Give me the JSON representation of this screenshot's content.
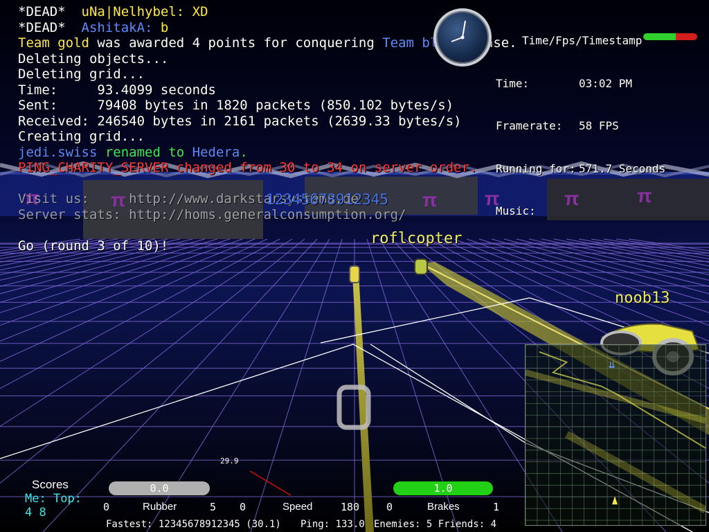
{
  "console": {
    "lines": [
      {
        "parts": [
          {
            "text": "*DEAD*  ",
            "color": "dead"
          },
          {
            "text": "uNa|Nelhybel: XD",
            "color": "gold"
          }
        ]
      },
      {
        "parts": [
          {
            "text": "*DEAD*  ",
            "color": "dead"
          },
          {
            "text": "AshitakA: ",
            "color": "blue"
          },
          {
            "text": "b",
            "color": "gold"
          }
        ]
      },
      {
        "parts": [
          {
            "text": "Team gold",
            "color": "gold"
          },
          {
            "text": " was awarded 4 points for conquering ",
            "color": "dead"
          },
          {
            "text": "Team blue",
            "color": "blue"
          },
          {
            "text": "'s base.",
            "color": "dead"
          }
        ]
      },
      {
        "parts": [
          {
            "text": "Deleting objects...",
            "color": "dead"
          }
        ]
      },
      {
        "parts": [
          {
            "text": "Deleting grid...",
            "color": "dead"
          }
        ]
      },
      {
        "parts": [
          {
            "text": "Time:     93.4099 seconds",
            "color": "dead"
          }
        ]
      },
      {
        "parts": [
          {
            "text": "Sent:     79408 bytes in 1820 packets (850.102 bytes/s)",
            "color": "dead"
          }
        ]
      },
      {
        "parts": [
          {
            "text": "Received: 246540 bytes in 2161 packets (2639.33 bytes/s)",
            "color": "dead"
          }
        ]
      },
      {
        "parts": [
          {
            "text": "Creating grid...",
            "color": "dead"
          }
        ]
      },
      {
        "parts": [
          {
            "text": "jedi.swiss",
            "color": "blue"
          },
          {
            "text": " renamed to ",
            "color": "green"
          },
          {
            "text": "Hedera",
            "color": "blue"
          },
          {
            "text": ".",
            "color": "green"
          }
        ]
      },
      {
        "parts": [
          {
            "text": "PING_CHARITY_SERVER changed from 30 to 34 on server order.",
            "color": "red"
          }
        ]
      },
      {
        "parts": [
          {
            "text": "",
            "color": "dead"
          }
        ]
      },
      {
        "parts": [
          {
            "text": "Visit us:     http://www.darkstarsystems.de",
            "color": "dim"
          }
        ]
      },
      {
        "parts": [
          {
            "text": "Server stats: http://homs.generalconsumption.org/",
            "color": "dim"
          }
        ]
      },
      {
        "parts": [
          {
            "text": "",
            "color": "dead"
          }
        ]
      },
      {
        "parts": [
          {
            "text": "Go (round 3 of 10)!",
            "color": "dead"
          }
        ]
      }
    ]
  },
  "hud": {
    "heading": "Time/Fps/Timestamp",
    "time_label": "Time:",
    "time_value": "03:02 PM",
    "framerate_label": "Framerate:",
    "framerate_value": "58 FPS",
    "running_label": "Running for:",
    "running_value": "571.7 Seconds",
    "music_label": "Music:",
    "music_value": "",
    "health_fraction": 0.6
  },
  "players": {
    "blue_name": "12345678912345",
    "name_1": "roflcopter",
    "name_2": "noob13"
  },
  "speed_readout": "29.9",
  "scores": {
    "title": "Scores",
    "me_label": "Me:",
    "top_label": "Top:",
    "me_value": "4",
    "top_value": "8"
  },
  "gauges": {
    "rubber": {
      "label": "Rubber",
      "min": "0",
      "max": "5",
      "value": "0.0",
      "fraction": 0
    },
    "speed": {
      "label": "Speed",
      "min": "0",
      "max": "180",
      "value": "29.9",
      "fraction": 0.166
    },
    "brakes": {
      "label": "Brakes",
      "min": "0",
      "max": "1",
      "value": "1.0",
      "fraction": 1.0
    }
  },
  "status": {
    "fastest": "Fastest: 12345678912345 (30.1)",
    "ping": "Ping: 133.0",
    "enemies_friends": "Enemies: 5 Friends: 4"
  },
  "colors": {
    "dead": "#ffffff",
    "gold": "#ffe84a",
    "blue": "#5b8cff",
    "green": "#3ee85a",
    "red": "#ff3b3b",
    "dim": "#c8c8c8",
    "grid": "#7f67d8",
    "wall_gold": "#b8b33a",
    "health_good": "#2fd12f",
    "health_bad": "#d41e1e",
    "brakes_pill": "#22d016",
    "rubber_pill": "#b0b0b0"
  }
}
